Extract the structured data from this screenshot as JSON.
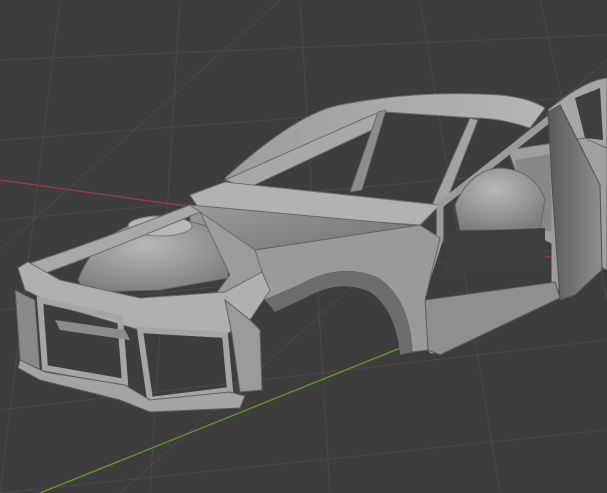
{
  "viewport": {
    "background": "#3d3d3d",
    "grid_color": "#4a4a4a",
    "x_axis_color": "#9a3c45",
    "y_axis_color": "#6c9a2c"
  },
  "scene": {
    "object": "car-body-shell-mesh",
    "shading": "solid",
    "base_color": "#9c9c9c",
    "light_color": "#bdbdbd",
    "shadow_color": "#5e5e5e",
    "dark_color": "#3a3a3a"
  }
}
